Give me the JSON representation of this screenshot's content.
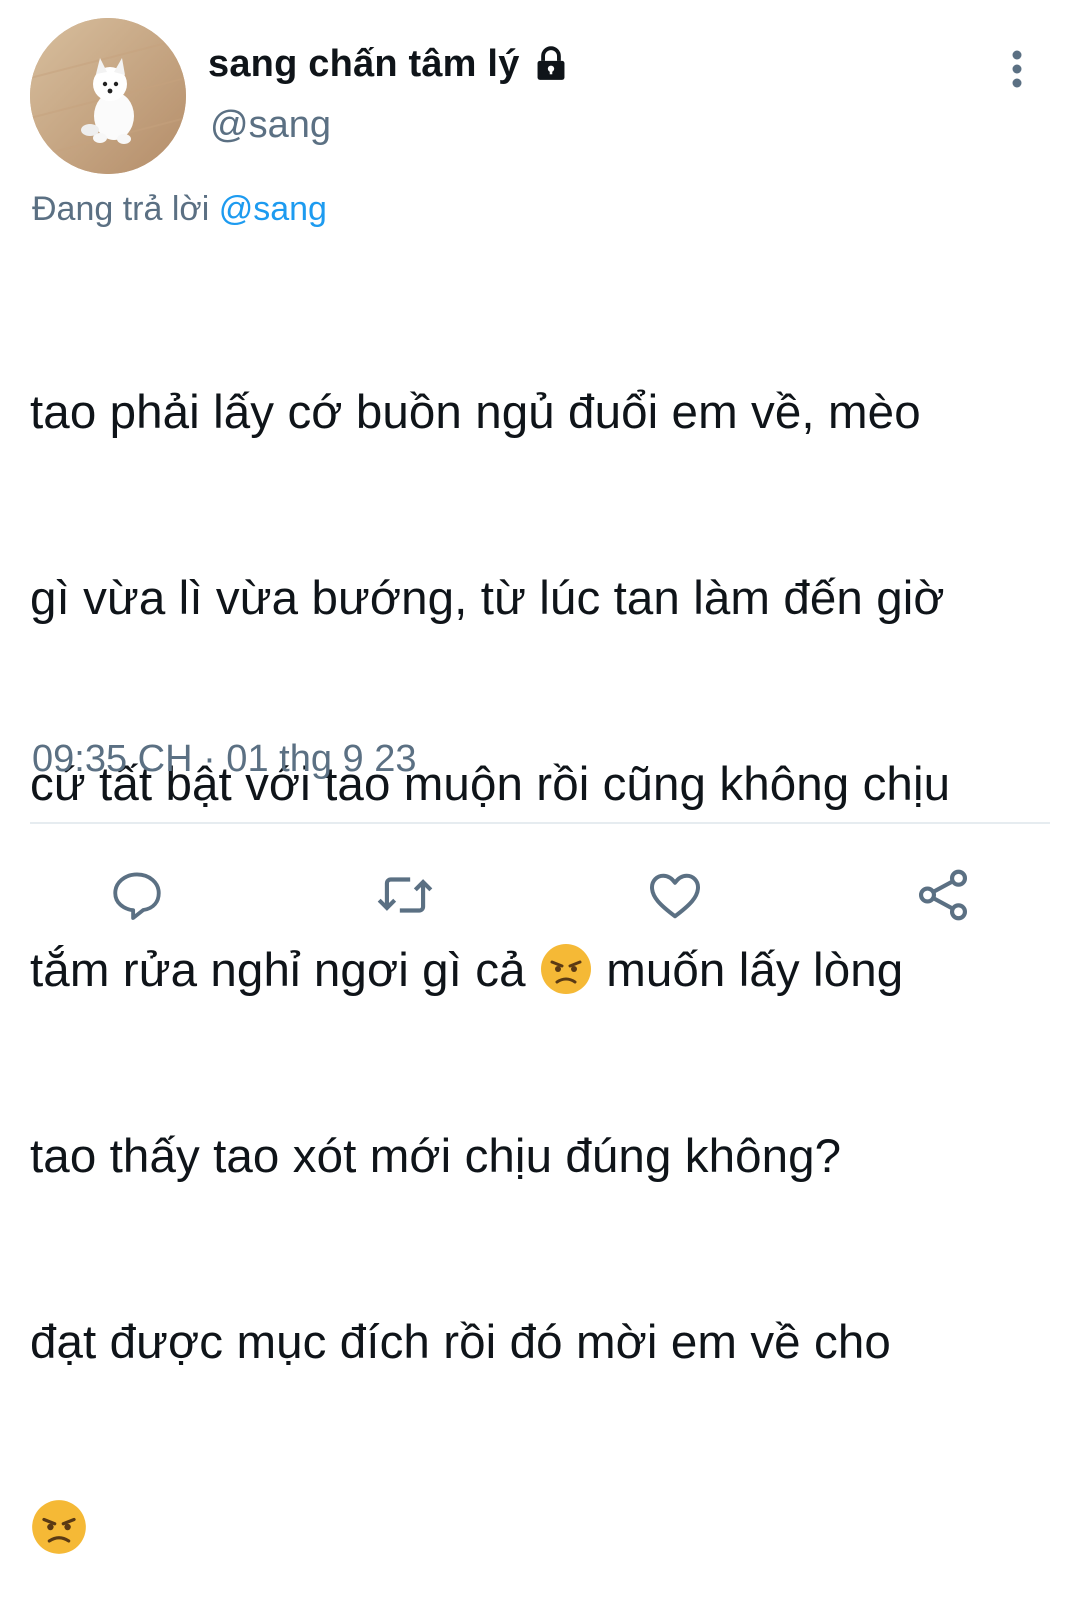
{
  "user": {
    "display_name": "sang chấn tâm lý",
    "handle": "@sang",
    "avatar_icon": "dog-avatar",
    "protected_icon": "lock-icon"
  },
  "reply": {
    "prefix": "Đang trả lời",
    "mention": "@sang"
  },
  "tweet": {
    "line1": "tao phải lấy cớ buồn ngủ đuổi em về, mèo",
    "line2": "gì vừa lì vừa bướng, từ lúc tan làm đến giờ",
    "line3": "cứ tất bật với tao muộn rồi cũng không chịu",
    "line4a": "tắm rửa nghỉ ngơi gì cả ",
    "line4b": " muốn lấy lòng",
    "line5": "tao thấy tao xót mới chịu đúng không?",
    "line6": "đạt được mục đích rồi đó mời em về cho",
    "emoji": "angry-face-icon"
  },
  "timestamp": "09:35 CH · 01 thg 9 23",
  "actions": [
    "reply-icon",
    "retweet-icon",
    "like-icon",
    "share-icon"
  ],
  "colors": {
    "text": "#0f1419",
    "secondary": "#5b7083",
    "link": "#1d9bf0",
    "divider": "#e6ecf0",
    "emoji": "#f5b936"
  }
}
